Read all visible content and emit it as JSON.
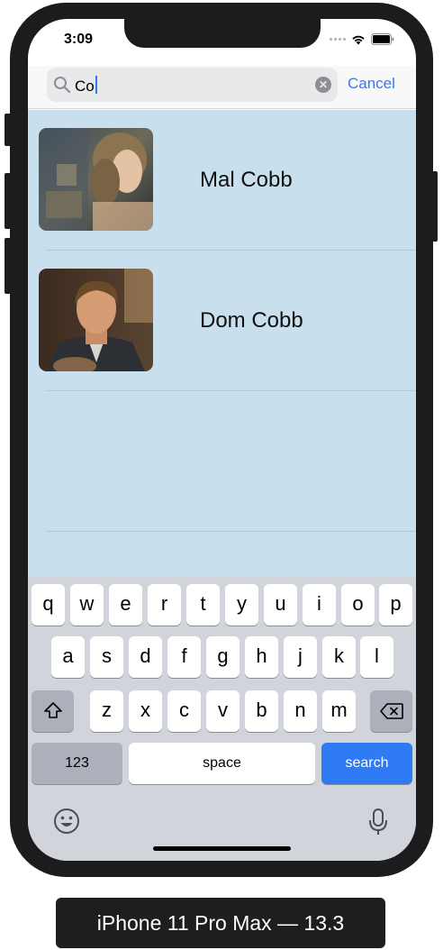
{
  "status_bar": {
    "time": "3:09",
    "icons": [
      "cellular-signal-icon",
      "wifi-icon",
      "battery-icon"
    ]
  },
  "search": {
    "query": "Co",
    "cancel_label": "Cancel",
    "icons": [
      "search-icon",
      "clear-text-icon"
    ]
  },
  "results": [
    {
      "name": "Mal Cobb",
      "photo": "mal-cobb-photo"
    },
    {
      "name": "Dom Cobb",
      "photo": "dom-cobb-photo"
    }
  ],
  "keyboard": {
    "row1": [
      "q",
      "w",
      "e",
      "r",
      "t",
      "y",
      "u",
      "i",
      "o",
      "p"
    ],
    "row2": [
      "a",
      "s",
      "d",
      "f",
      "g",
      "h",
      "j",
      "k",
      "l"
    ],
    "row3": [
      "z",
      "x",
      "c",
      "v",
      "b",
      "n",
      "m"
    ],
    "numbers_label": "123",
    "space_label": "space",
    "return_label": "search",
    "icons": [
      "shift-icon",
      "backspace-icon",
      "emoji-icon",
      "microphone-icon"
    ]
  },
  "device_label": "iPhone 11 Pro Max — 13.3",
  "colors": {
    "accent": "#2f7bf5",
    "results_background": "#c8dfed",
    "keyboard_background": "#d1d4da",
    "device_frame": "#1c1c1e"
  }
}
